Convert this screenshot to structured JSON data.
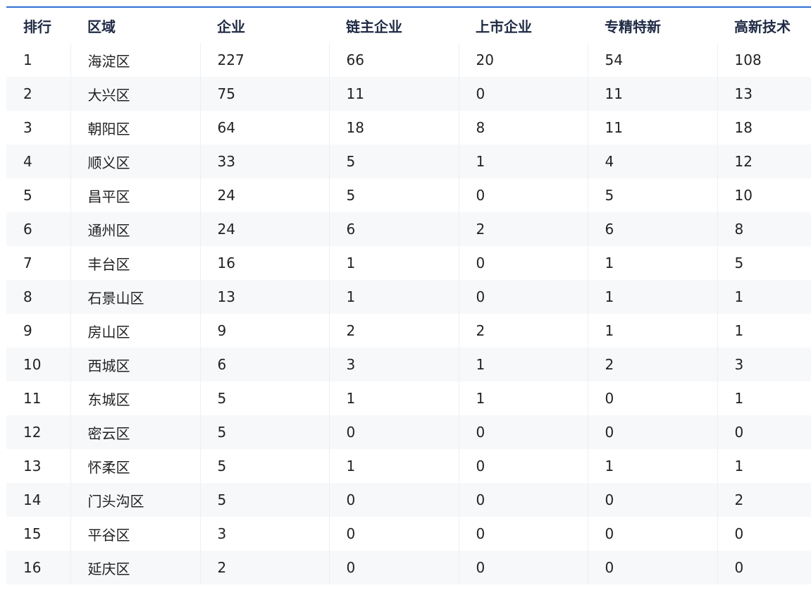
{
  "table": {
    "headers": [
      "排行",
      "区域",
      "企业",
      "链主企业",
      "上市企业",
      "专精特新",
      "高新技术"
    ],
    "rows": [
      [
        "1",
        "海淀区",
        "227",
        "66",
        "20",
        "54",
        "108"
      ],
      [
        "2",
        "大兴区",
        "75",
        "11",
        "0",
        "11",
        "13"
      ],
      [
        "3",
        "朝阳区",
        "64",
        "18",
        "8",
        "11",
        "18"
      ],
      [
        "4",
        "顺义区",
        "33",
        "5",
        "1",
        "4",
        "12"
      ],
      [
        "5",
        "昌平区",
        "24",
        "5",
        "0",
        "5",
        "10"
      ],
      [
        "6",
        "通州区",
        "24",
        "6",
        "2",
        "6",
        "8"
      ],
      [
        "7",
        "丰台区",
        "16",
        "1",
        "0",
        "1",
        "5"
      ],
      [
        "8",
        "石景山区",
        "13",
        "1",
        "0",
        "1",
        "1"
      ],
      [
        "9",
        "房山区",
        "9",
        "2",
        "2",
        "1",
        "1"
      ],
      [
        "10",
        "西城区",
        "6",
        "3",
        "1",
        "2",
        "3"
      ],
      [
        "11",
        "东城区",
        "5",
        "1",
        "1",
        "0",
        "1"
      ],
      [
        "12",
        "密云区",
        "5",
        "0",
        "0",
        "0",
        "0"
      ],
      [
        "13",
        "怀柔区",
        "5",
        "1",
        "0",
        "1",
        "1"
      ],
      [
        "14",
        "门头沟区",
        "5",
        "0",
        "0",
        "0",
        "2"
      ],
      [
        "15",
        "平谷区",
        "3",
        "0",
        "0",
        "0",
        "0"
      ],
      [
        "16",
        "延庆区",
        "2",
        "0",
        "0",
        "0",
        "0"
      ]
    ]
  },
  "colors": {
    "header_rule": "#2f6fd6",
    "stripe": "#f7f8fa",
    "divider": "#eceff3"
  }
}
